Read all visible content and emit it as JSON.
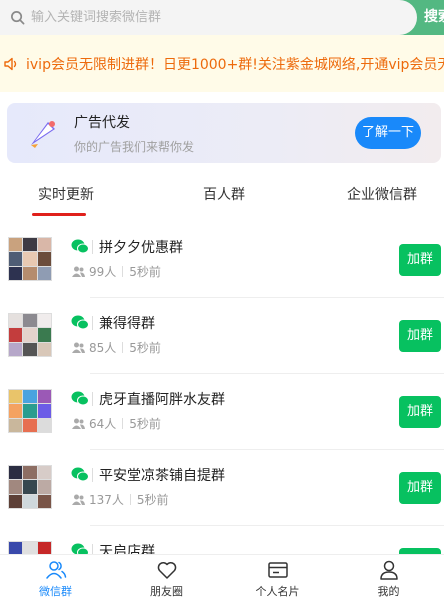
{
  "search": {
    "placeholder": "输入关键词搜索微信群",
    "button_label": "搜索"
  },
  "notice": {
    "text": "ivip会员无限制进群！日更1000+群!关注紫金城网络,开通vip会员无限制进群"
  },
  "ad": {
    "title": "广告代发",
    "subtitle": "你的广告我们来帮你发",
    "button_label": "了解一下"
  },
  "tabs": [
    {
      "label": "实时更新",
      "active": true
    },
    {
      "label": "百人群",
      "active": false
    },
    {
      "label": "企业微信群",
      "active": false
    }
  ],
  "groups": [
    {
      "name": "拼夕夕优惠群",
      "members": "99人",
      "time": "5秒前",
      "join_label": "加群"
    },
    {
      "name": "兼得得群",
      "members": "85人",
      "time": "5秒前",
      "join_label": "加群"
    },
    {
      "name": "虎牙直播阿胖水友群",
      "members": "64人",
      "time": "5秒前",
      "join_label": "加群"
    },
    {
      "name": "平安堂凉茶铺自提群",
      "members": "137人",
      "time": "5秒前",
      "join_label": "加群"
    },
    {
      "name": "天启店群",
      "members": "",
      "time": "",
      "join_label": "加群"
    }
  ],
  "nav": [
    {
      "label": "微信群",
      "icon": "users-icon",
      "active": true
    },
    {
      "label": "朋友圈",
      "icon": "heart-icon",
      "active": false
    },
    {
      "label": "个人名片",
      "icon": "card-icon",
      "active": false
    },
    {
      "label": "我的",
      "icon": "user-icon",
      "active": false
    }
  ],
  "colors": {
    "accent_green": "#07c160",
    "search_bar_green": "#53b882",
    "notice_orange": "#ed6a0c",
    "button_blue": "#1989fa",
    "tab_underline_red": "#e0201b"
  }
}
